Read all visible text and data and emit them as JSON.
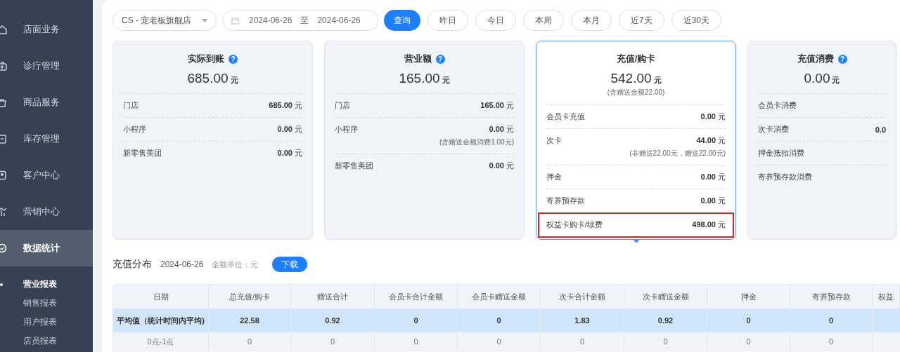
{
  "sidebar": {
    "items": [
      {
        "label": "店面业务",
        "selected": false
      },
      {
        "label": "诊疗管理",
        "selected": false
      },
      {
        "label": "商品服务",
        "selected": false
      },
      {
        "label": "库存管理",
        "selected": false
      },
      {
        "label": "客户中心",
        "selected": false
      },
      {
        "label": "营销中心",
        "selected": false
      },
      {
        "label": "数据统计",
        "selected": true,
        "children": [
          {
            "label": "营业报表",
            "selected": true
          },
          {
            "label": "销售报表",
            "selected": false
          },
          {
            "label": "用户报表",
            "selected": false
          },
          {
            "label": "店员报表",
            "selected": false
          }
        ]
      }
    ]
  },
  "filters": {
    "store_select": {
      "value": "CS - 宠老板旗舰店"
    },
    "date_range": {
      "start": "2024-06-26",
      "separator": "至",
      "end": "2024-06-26"
    },
    "query_button": "查询",
    "quick_ranges": [
      {
        "label": "昨日"
      },
      {
        "label": "今日"
      },
      {
        "label": "本周"
      },
      {
        "label": "本月"
      },
      {
        "label": "近7天"
      },
      {
        "label": "近30天"
      }
    ]
  },
  "cards": [
    {
      "title": "实际到账",
      "help_icon": "?",
      "amount": "685.00",
      "unit": "元",
      "selected": false,
      "rows": [
        {
          "label": "门店",
          "value": "685.00",
          "unit": "元",
          "highlighted": false
        },
        {
          "label": "小程序",
          "value": "0.00",
          "unit": "元",
          "highlighted": false
        },
        {
          "label": "新零售美团",
          "value": "0.00",
          "unit": "元",
          "highlighted": false
        }
      ]
    },
    {
      "title": "营业额",
      "help_icon": "?",
      "amount": "165.00",
      "unit": "元",
      "selected": false,
      "rows": [
        {
          "label": "门店",
          "value": "165.00",
          "unit": "元",
          "highlighted": false
        },
        {
          "label": "小程序",
          "value": "0.00",
          "unit": "元",
          "note": "(含赠送金额消费1.00元)",
          "highlighted": false
        },
        {
          "label": "新零售美团",
          "value": "0.00",
          "unit": "元",
          "highlighted": false
        }
      ]
    },
    {
      "title": "充值/购卡",
      "amount": "542.00",
      "unit": "元",
      "note": "(含赠送金额22.00)",
      "selected": true,
      "rows": [
        {
          "label": "会员卡充值",
          "value": "0.00",
          "unit": "元",
          "highlighted": false
        },
        {
          "label": "次卡",
          "value": "44.00",
          "unit": "元",
          "note": "(非赠送22.00元，赠送22.00元)",
          "highlighted": false
        },
        {
          "label": "押金",
          "value": "0.00",
          "unit": "元",
          "highlighted": false
        },
        {
          "label": "寄养预存款",
          "value": "0.00",
          "unit": "元",
          "highlighted": false
        },
        {
          "label": "权益卡购卡/续费",
          "value": "498.00",
          "unit": "元",
          "highlighted": true
        }
      ]
    },
    {
      "title": "充值消费",
      "help_icon": "?",
      "amount": "0.00",
      "unit": "元",
      "selected": false,
      "rows": [
        {
          "label": "会员卡消费",
          "highlighted": false
        },
        {
          "label": "次卡消费",
          "value": "0.0",
          "highlighted": false
        },
        {
          "label": "押金抵扣消费",
          "highlighted": false
        },
        {
          "label": "寄养预存款消费",
          "highlighted": false
        }
      ]
    }
  ],
  "section": {
    "title": "充值分布",
    "date": "2024-06-26",
    "unit_label": "金额单位：元",
    "download_button": "下载"
  },
  "table": {
    "columns": [
      "日期",
      "总充值/购卡",
      "赠送合计",
      "会员卡合计金额",
      "会员卡赠送金额",
      "次卡合计金额",
      "次卡赠送金额",
      "押金",
      "寄养预存款",
      "权益"
    ],
    "rows": [
      {
        "highlighted": true,
        "cells": [
          "平均值（统计时间内平均)",
          "22.58",
          "0.92",
          "0",
          "0",
          "1.83",
          "0.92",
          "0",
          "0"
        ]
      },
      {
        "highlighted": false,
        "cells": [
          "0点-1点",
          "0",
          "0",
          "0",
          "0",
          "0",
          "0",
          "0",
          "0"
        ]
      }
    ]
  }
}
